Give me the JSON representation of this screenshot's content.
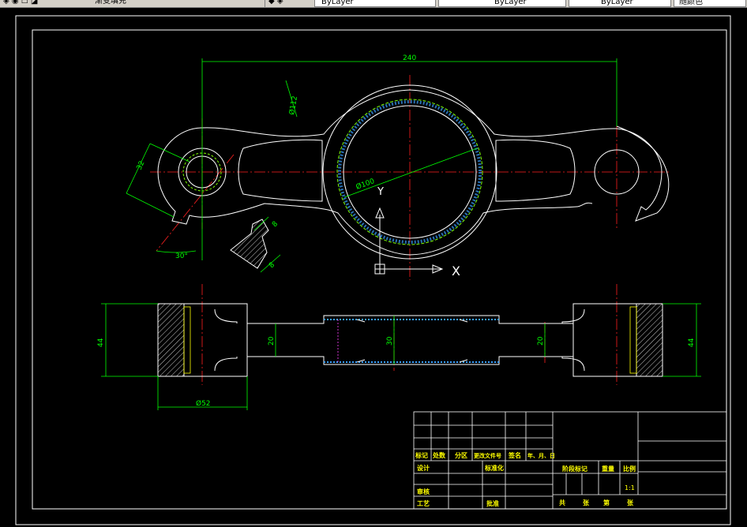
{
  "toolbar": {
    "items": [
      "渐变填充",
      "ByLayer",
      "ByLayer",
      "ByLayer",
      "随颜色"
    ]
  },
  "dimensions": {
    "overall_length": "240",
    "radius_top": "Ø112",
    "diameter_center": "Ø100",
    "width_left": "32",
    "angle": "30°",
    "section_h1": "8",
    "section_h2": "8",
    "side_left_height": "44",
    "side_right_height": "44",
    "side_left_width": "20",
    "side_center": "30",
    "side_right_width": "20",
    "side_bottom": "Ø52"
  },
  "ucs": {
    "x_label": "X",
    "y_label": "Y"
  },
  "title_block": {
    "row_labels": [
      "标记",
      "处数",
      "分区",
      "更改文件号",
      "签名",
      "年、月、日"
    ],
    "design": "设计",
    "standardize": "标准化",
    "review": "审核",
    "process": "工艺",
    "approve": "批准",
    "stage_mark": "阶段标记",
    "weight": "重量",
    "scale": "比例",
    "scale_value": "1:1",
    "total": "共",
    "sheets": "张",
    "page": "第",
    "sheets2": "张"
  }
}
